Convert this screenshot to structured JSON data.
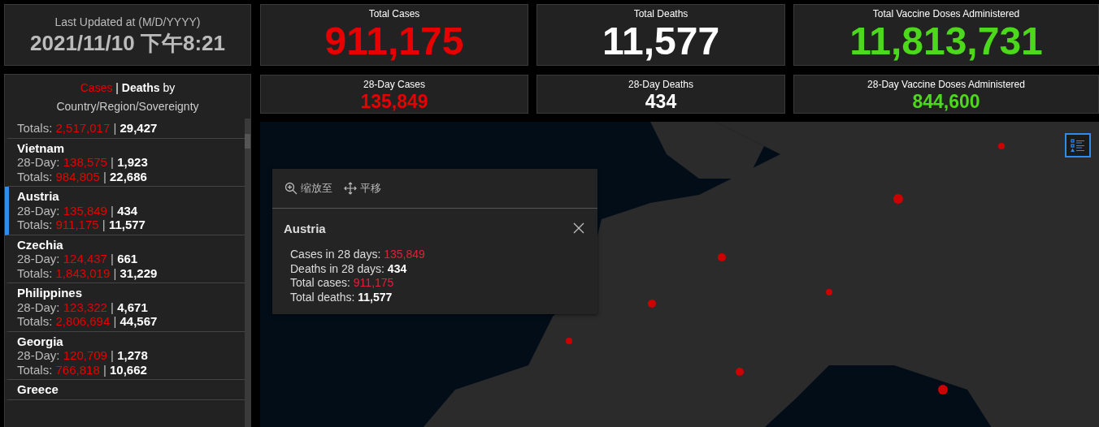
{
  "last_updated": {
    "label": "Last Updated at (M/D/YYYY)",
    "value": "2021/11/10 下午8:21"
  },
  "stats": [
    {
      "label": "Total Cases",
      "value": "911,175",
      "kind": "cases"
    },
    {
      "label": "Total Deaths",
      "value": "11,577",
      "kind": "deaths"
    },
    {
      "label": "Total Vaccine Doses Administered",
      "value": "11,813,731",
      "kind": "vaccine"
    }
  ],
  "stats_28day": [
    {
      "label": "28-Day Cases",
      "value": "135,849",
      "kind": "cases"
    },
    {
      "label": "28-Day Deaths",
      "value": "434",
      "kind": "deaths"
    },
    {
      "label": "28-Day Vaccine Doses Administered",
      "value": "844,600",
      "kind": "vaccine"
    }
  ],
  "country_list": {
    "title_cases": "Cases",
    "separator": "|",
    "title_deaths": "Deaths",
    "title_rest": "by",
    "subtitle": "Country/Region/Sovereignty",
    "rows": [
      {
        "selected": false,
        "totals_label": "Totals:",
        "totals_cases": "2,517,017",
        "totals_deaths": "29,427"
      },
      {
        "selected": false,
        "name": "Vietnam",
        "day_label": "28-Day:",
        "day_cases": "138,575",
        "day_deaths": "1,923",
        "totals_label": "Totals:",
        "totals_cases": "984,805",
        "totals_deaths": "22,686"
      },
      {
        "selected": true,
        "name": "Austria",
        "day_label": "28-Day:",
        "day_cases": "135,849",
        "day_deaths": "434",
        "totals_label": "Totals:",
        "totals_cases": "911,175",
        "totals_deaths": "11,577"
      },
      {
        "selected": false,
        "name": "Czechia",
        "day_label": "28-Day:",
        "day_cases": "124,437",
        "day_deaths": "661",
        "totals_label": "Totals:",
        "totals_cases": "1,843,019",
        "totals_deaths": "31,229"
      },
      {
        "selected": false,
        "name": "Philippines",
        "day_label": "28-Day:",
        "day_cases": "123,322",
        "day_deaths": "4,671",
        "totals_label": "Totals:",
        "totals_cases": "2,806,694",
        "totals_deaths": "44,567"
      },
      {
        "selected": false,
        "name": "Georgia",
        "day_label": "28-Day:",
        "day_cases": "120,709",
        "day_deaths": "1,278",
        "totals_label": "Totals:",
        "totals_cases": "766,818",
        "totals_deaths": "10,662"
      },
      {
        "selected": false,
        "name": "Greece"
      }
    ]
  },
  "popup": {
    "actions": [
      {
        "label": "缩放至",
        "kind": "zoom"
      },
      {
        "label": "平移",
        "kind": "pan"
      }
    ],
    "title": "Austria",
    "lines": [
      {
        "label": "Cases in 28 days:",
        "value": "135,849",
        "kind": "cases"
      },
      {
        "label": "Deaths in 28 days:",
        "value": "434",
        "kind": "deaths"
      },
      {
        "label": "Total cases:",
        "value": "911,175",
        "kind": "cases"
      },
      {
        "label": "Total deaths:",
        "value": "11,577",
        "kind": "deaths"
      }
    ]
  }
}
